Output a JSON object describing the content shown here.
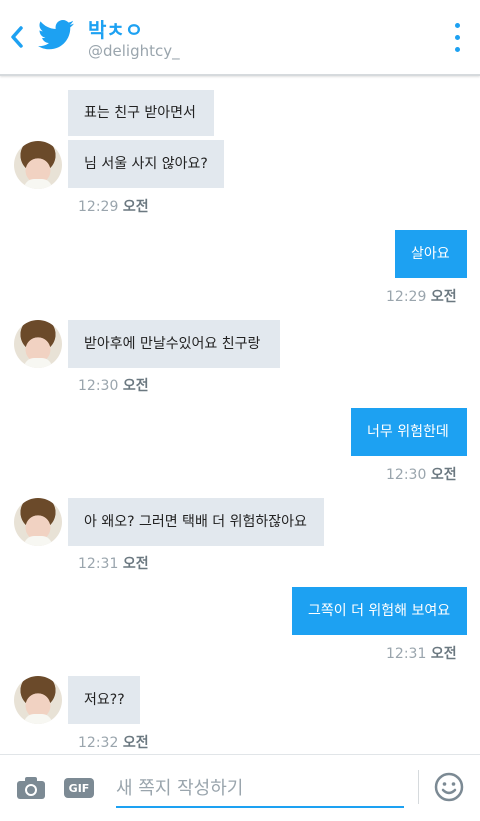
{
  "header": {
    "name": "박ㅊㅇ",
    "handle": "@delightcy_"
  },
  "messages": [
    {
      "side": "in",
      "text": "표는 친구 받아면서"
    },
    {
      "side": "in",
      "text": "님 서울 사지 않아요?"
    },
    {
      "side": "out",
      "text": "살아요"
    },
    {
      "side": "in",
      "text": "받아후에 만날수있어요 친구랑"
    },
    {
      "side": "out",
      "text": "너무 위험한데"
    },
    {
      "side": "in",
      "text": "아 왜오? 그러면 택배 더 위험하잖아요"
    },
    {
      "side": "out",
      "text": "그쪽이 더 위험해 보여요"
    },
    {
      "side": "in",
      "text": "저요??"
    }
  ],
  "timestamps": [
    {
      "time": "12:29",
      "ampm": "오전"
    },
    {
      "time": "12:29",
      "ampm": "오전"
    },
    {
      "time": "12:30",
      "ampm": "오전"
    },
    {
      "time": "12:30",
      "ampm": "오전"
    },
    {
      "time": "12:31",
      "ampm": "오전"
    },
    {
      "time": "12:31",
      "ampm": "오전"
    },
    {
      "time": "12:32",
      "ampm": "오전"
    }
  ],
  "composer": {
    "placeholder": "새 쪽지 작성하기",
    "gif_label": "GIF"
  },
  "colors": {
    "accent": "#1da1f2",
    "incoming_bubble": "#e2e8ee",
    "muted": "#9aa5ad"
  },
  "icons": [
    "back-icon",
    "twitter-bird-icon",
    "more-vert-icon",
    "camera-icon",
    "gif-icon",
    "emoji-icon"
  ]
}
